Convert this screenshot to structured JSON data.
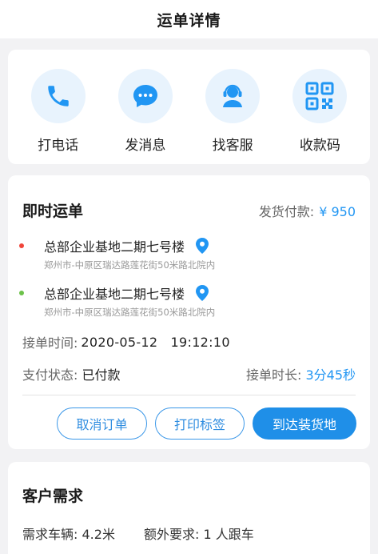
{
  "header": {
    "title": "运单详情"
  },
  "actions": [
    {
      "label": "打电话",
      "icon": "phone-icon"
    },
    {
      "label": "发消息",
      "icon": "chat-icon"
    },
    {
      "label": "找客服",
      "icon": "customer-service-icon"
    },
    {
      "label": "收款码",
      "icon": "qr-code-icon"
    }
  ],
  "order": {
    "type": "即时运单",
    "pay_label": "发货付款:",
    "pay_amount": "¥ 950",
    "pickup": {
      "name": "总部企业基地二期七号楼",
      "detail": "郑州市-中原区瑞达路莲花街50米路北院内"
    },
    "dropoff": {
      "name": "总部企业基地二期七号楼",
      "detail": "郑州市-中原区瑞达路莲花街50米路北院内"
    },
    "accept_time_label": "接单时间:",
    "accept_time": "2020-05-12   19:12:10",
    "pay_status_label": "支付状态:",
    "pay_status": "已付款",
    "duration_label": "接单时长:",
    "duration": "3分45秒",
    "buttons": {
      "cancel": "取消订单",
      "print": "打印标签",
      "arrive": "到达装货地"
    }
  },
  "demand": {
    "title": "客户需求",
    "vehicle_label": "需求车辆:",
    "vehicle": "4.2米",
    "extra_label": "额外要求:",
    "extra": "1 人跟车"
  },
  "colors": {
    "accent": "#1f8fe8",
    "icon_bg": "#e8f3fd",
    "pickup_dot": "#f0453a",
    "dropoff_dot": "#6cc24a"
  }
}
